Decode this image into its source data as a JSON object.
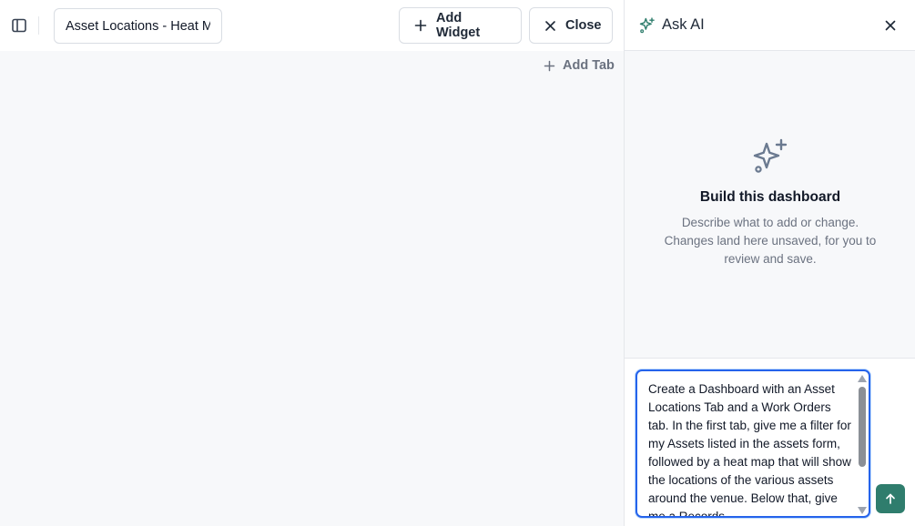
{
  "toolbar": {
    "dashboard_title": "Asset Locations - Heat Map",
    "add_widget_label": "Add Widget",
    "close_label": "Close"
  },
  "tabs": {
    "add_tab_label": "Add Tab"
  },
  "ai_panel": {
    "title": "Ask AI",
    "empty_title": "Build this dashboard",
    "empty_description": "Describe what to add or change. Changes land here unsaved, for you to review and save.",
    "prompt_text": "Create a Dashboard with an Asset Locations Tab and a Work Orders tab. In the first tab, give me a filter for my Assets listed in the assets form, followed by a heat map that will show the locations of the various assets around the venue. Below that, give me a Records"
  },
  "colors": {
    "accent": "#2563eb",
    "send_button": "#2f7d6d",
    "ai_icon": "#2f7d6d",
    "muted_text": "#6b7280"
  },
  "icons": {
    "sidebar_toggle": "sidebar-icon",
    "add_widget": "plus-icon",
    "close": "x-icon",
    "add_tab": "plus-icon",
    "ai": "sparkles-icon",
    "ai_close": "x-icon",
    "empty_state": "sparkles-icon",
    "send": "arrow-up-icon"
  }
}
